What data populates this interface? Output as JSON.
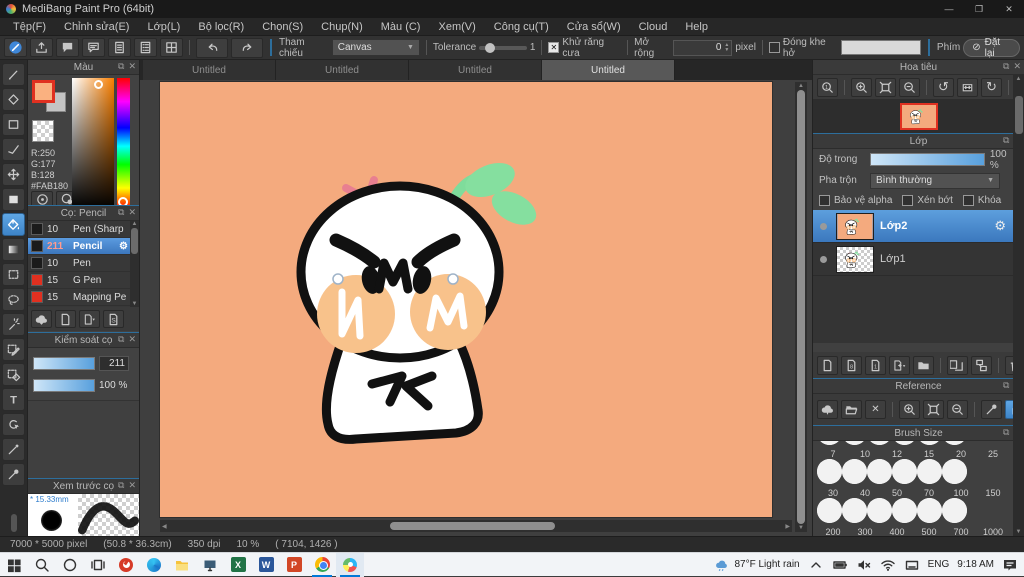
{
  "window": {
    "title": "MediBang Paint Pro (64bit)"
  },
  "icons": {
    "close": "✕",
    "popout": "⧉",
    "gear": "⚙",
    "rotate_ccw": "↺",
    "rotate_cw": "↻",
    "slash_reset": "⊘",
    "up": "▲",
    "down": "▼",
    "dropdown": "▼",
    "check": "✕",
    "minimize": "—",
    "maximize": "❐"
  },
  "menubar": {
    "items": [
      "Tệp(F)",
      "Chỉnh sửa(E)",
      "Lớp(L)",
      "Bộ lọc(R)",
      "Chọn(S)",
      "Chụp(N)",
      "Màu (C)",
      "Xem(V)",
      "Công cụ(T)",
      "Cửa sổ(W)",
      "Cloud",
      "Help"
    ]
  },
  "toolbar": {
    "ref_label": "Tham chiếu",
    "ref_value": "Canvas",
    "tolerance_label": "Tolerance",
    "tolerance_value": "1",
    "antialias_label": "Khử răng cưa",
    "expand_label": "Mở rộng",
    "expand_value": "0",
    "expand_unit": "pixel",
    "close_gap_label": "Đóng khe hở",
    "key_label": "Phím",
    "reset_label": "Đặt lại"
  },
  "color_panel": {
    "title": "Màu",
    "r_label": "R:250",
    "g_label": "G:177",
    "b_label": "B:128",
    "hex_label": "#FAB180",
    "fg_color": "#FAB180"
  },
  "brush_panel": {
    "title": "Cọ: Pencil",
    "brushes": [
      {
        "size": "10",
        "name": "Pen (Sharp",
        "swatch": "#1b1b1b"
      },
      {
        "size": "211",
        "name": "Pencil",
        "swatch": "#1b1b1b"
      },
      {
        "size": "10",
        "name": "Pen",
        "swatch": "#1b1b1b"
      },
      {
        "size": "15",
        "name": "G Pen",
        "swatch": "#e03020"
      },
      {
        "size": "15",
        "name": "Mapping Pe",
        "swatch": "#e03020"
      }
    ]
  },
  "brush_control": {
    "title": "Kiểm soát cọ",
    "size_value": "211",
    "opacity_value": "100 %"
  },
  "brush_preview": {
    "title": "Xem trước cọ",
    "size_label": "15.33mm"
  },
  "canvas_tabs": {
    "items": [
      "Untitled",
      "Untitled",
      "Untitled",
      "Untitled"
    ],
    "selected_index": 3
  },
  "canvas": {
    "bg_color": "#F4AA7E",
    "zoom": "10 %"
  },
  "navigator": {
    "title": "Hoa tiêu"
  },
  "layer_panel": {
    "title": "Lớp",
    "opacity_label": "Độ trong",
    "opacity_value": "100 %",
    "blend_label": "Pha trộn",
    "blend_value": "Bình thường",
    "alpha_label": "Bảo vệ alpha",
    "clip_label": "Xén bớt",
    "lock_label": "Khóa",
    "layers": [
      {
        "name": "Lớp2"
      },
      {
        "name": "Lớp1"
      }
    ]
  },
  "reference_panel": {
    "title": "Reference"
  },
  "brush_size_panel": {
    "title": "Brush Size",
    "rows": [
      [
        "7",
        "10",
        "12",
        "15",
        "20",
        "25"
      ],
      [
        "30",
        "40",
        "50",
        "70",
        "100",
        "150"
      ],
      [
        "200",
        "300",
        "400",
        "500",
        "700",
        "1000"
      ]
    ]
  },
  "statusbar": {
    "size": "7000 * 5000 pixel",
    "dimensions": "(50.8 * 36.3cm)",
    "dpi": "350 dpi",
    "zoom": "10 %",
    "coords": "( 7104, 1426 )"
  },
  "taskbar": {
    "weather": "87°F Light rain",
    "language": "ENG",
    "time": "9:18 AM"
  }
}
